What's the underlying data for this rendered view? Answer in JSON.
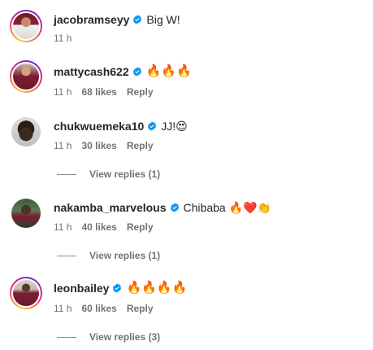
{
  "comments": [
    {
      "username": "jacobramseyy",
      "text": "Big W!",
      "time": "11 h",
      "likes": "",
      "reply": "",
      "view_replies": ""
    },
    {
      "username": "mattycash622",
      "text": "🔥🔥🔥",
      "time": "11 h",
      "likes": "68 likes",
      "reply": "Reply",
      "view_replies": ""
    },
    {
      "username": "chukwuemeka10",
      "text": "JJ!😍",
      "time": "11 h",
      "likes": "30 likes",
      "reply": "Reply",
      "view_replies": "View replies (1)"
    },
    {
      "username": "nakamba_marvelous",
      "text": "Chibaba 🔥❤️👏",
      "time": "11 h",
      "likes": "40 likes",
      "reply": "Reply",
      "view_replies": "View replies (1)"
    },
    {
      "username": "leonbailey",
      "text": "🔥🔥🔥🔥",
      "time": "11 h",
      "likes": "60 likes",
      "reply": "Reply",
      "view_replies": "View replies (3)"
    }
  ],
  "colors": {
    "verified_badge": "#0095f6",
    "secondary_text": "#737373",
    "primary_text": "#262626"
  },
  "icons": {
    "verified": "verified-badge-icon"
  }
}
